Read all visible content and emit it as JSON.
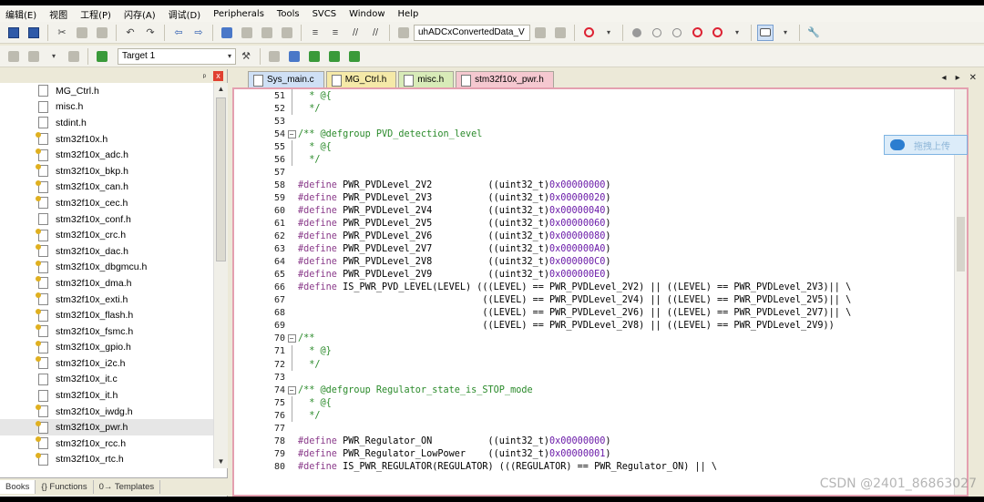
{
  "menu": [
    "编辑(E)",
    "视图",
    "工程(P)",
    "闪存(A)",
    "调试(D)",
    "Peripherals",
    "Tools",
    "SVCS",
    "Window",
    "Help"
  ],
  "toolbar": {
    "function_combo": "uhADCxConvertedData_V",
    "target_combo": "Target 1"
  },
  "project_panel": {
    "pin_label": "ᵖ",
    "close_label": "x",
    "files": [
      {
        "name": "MG_Ctrl.h",
        "key": false
      },
      {
        "name": "misc.h",
        "key": false
      },
      {
        "name": "stdint.h",
        "key": false
      },
      {
        "name": "stm32f10x.h",
        "key": true
      },
      {
        "name": "stm32f10x_adc.h",
        "key": true
      },
      {
        "name": "stm32f10x_bkp.h",
        "key": true
      },
      {
        "name": "stm32f10x_can.h",
        "key": true
      },
      {
        "name": "stm32f10x_cec.h",
        "key": true
      },
      {
        "name": "stm32f10x_conf.h",
        "key": false
      },
      {
        "name": "stm32f10x_crc.h",
        "key": true
      },
      {
        "name": "stm32f10x_dac.h",
        "key": true
      },
      {
        "name": "stm32f10x_dbgmcu.h",
        "key": true
      },
      {
        "name": "stm32f10x_dma.h",
        "key": true
      },
      {
        "name": "stm32f10x_exti.h",
        "key": true
      },
      {
        "name": "stm32f10x_flash.h",
        "key": true
      },
      {
        "name": "stm32f10x_fsmc.h",
        "key": true
      },
      {
        "name": "stm32f10x_gpio.h",
        "key": true
      },
      {
        "name": "stm32f10x_i2c.h",
        "key": true
      },
      {
        "name": "stm32f10x_it.c",
        "key": false
      },
      {
        "name": "stm32f10x_it.h",
        "key": false
      },
      {
        "name": "stm32f10x_iwdg.h",
        "key": true
      },
      {
        "name": "stm32f10x_pwr.h",
        "key": true,
        "selected": true
      },
      {
        "name": "stm32f10x_rcc.h",
        "key": true
      },
      {
        "name": "stm32f10x_rtc.h",
        "key": true
      }
    ],
    "tabs": [
      "Books",
      "{} Functions",
      "0→ Templates"
    ]
  },
  "editor": {
    "tabs": [
      "Sys_main.c",
      "MG_Ctrl.h",
      "misc.h",
      "stm32f10x_pwr.h"
    ],
    "active_tab": 3,
    "lines": [
      {
        "n": "51",
        "fold": "line",
        "t": "  * @{",
        "c": "cmt"
      },
      {
        "n": "52",
        "fold": "line",
        "t": "  */",
        "c": "cmt"
      },
      {
        "n": "53",
        "fold": "",
        "t": "",
        "c": "txt"
      },
      {
        "n": "54",
        "fold": "box",
        "t": "/** @defgroup PVD_detection_level",
        "c": "cmt"
      },
      {
        "n": "55",
        "fold": "line",
        "t": "  * @{",
        "c": "cmt"
      },
      {
        "n": "56",
        "fold": "line",
        "t": "  */",
        "c": "cmt"
      },
      {
        "n": "57",
        "fold": "",
        "t": "",
        "c": "txt"
      },
      {
        "n": "58",
        "fold": "",
        "pp": "#define",
        "t": " PWR_PVDLevel_2V2          ((uint32_t)",
        "hex": "0x00000000",
        "tail": ")"
      },
      {
        "n": "59",
        "fold": "",
        "pp": "#define",
        "t": " PWR_PVDLevel_2V3          ((uint32_t)",
        "hex": "0x00000020",
        "tail": ")"
      },
      {
        "n": "60",
        "fold": "",
        "pp": "#define",
        "t": " PWR_PVDLevel_2V4          ((uint32_t)",
        "hex": "0x00000040",
        "tail": ")"
      },
      {
        "n": "61",
        "fold": "",
        "pp": "#define",
        "t": " PWR_PVDLevel_2V5          ((uint32_t)",
        "hex": "0x00000060",
        "tail": ")"
      },
      {
        "n": "62",
        "fold": "",
        "pp": "#define",
        "t": " PWR_PVDLevel_2V6          ((uint32_t)",
        "hex": "0x00000080",
        "tail": ")"
      },
      {
        "n": "63",
        "fold": "",
        "pp": "#define",
        "t": " PWR_PVDLevel_2V7          ((uint32_t)",
        "hex": "0x000000A0",
        "tail": ")"
      },
      {
        "n": "64",
        "fold": "",
        "pp": "#define",
        "t": " PWR_PVDLevel_2V8          ((uint32_t)",
        "hex": "0x000000C0",
        "tail": ")"
      },
      {
        "n": "65",
        "fold": "",
        "pp": "#define",
        "t": " PWR_PVDLevel_2V9          ((uint32_t)",
        "hex": "0x000000E0",
        "tail": ")"
      },
      {
        "n": "66",
        "fold": "",
        "pp": "#define",
        "t": " IS_PWR_PVD_LEVEL(LEVEL) (((LEVEL) == PWR_PVDLevel_2V2) || ((LEVEL) == PWR_PVDLevel_2V3)|| \\"
      },
      {
        "n": "67",
        "fold": "",
        "t": "                                 ((LEVEL) == PWR_PVDLevel_2V4) || ((LEVEL) == PWR_PVDLevel_2V5)|| \\"
      },
      {
        "n": "68",
        "fold": "",
        "t": "                                 ((LEVEL) == PWR_PVDLevel_2V6) || ((LEVEL) == PWR_PVDLevel_2V7)|| \\"
      },
      {
        "n": "69",
        "fold": "",
        "t": "                                 ((LEVEL) == PWR_PVDLevel_2V8) || ((LEVEL) == PWR_PVDLevel_2V9))"
      },
      {
        "n": "70",
        "fold": "box",
        "t": "/**",
        "c": "cmt"
      },
      {
        "n": "71",
        "fold": "line",
        "t": "  * @}",
        "c": "cmt"
      },
      {
        "n": "72",
        "fold": "line",
        "t": "  */",
        "c": "cmt"
      },
      {
        "n": "73",
        "fold": "",
        "t": "",
        "c": "txt"
      },
      {
        "n": "74",
        "fold": "box",
        "t": "/** @defgroup Regulator_state_is_STOP_mode",
        "c": "cmt"
      },
      {
        "n": "75",
        "fold": "line",
        "t": "  * @{",
        "c": "cmt"
      },
      {
        "n": "76",
        "fold": "line",
        "t": "  */",
        "c": "cmt"
      },
      {
        "n": "77",
        "fold": "",
        "t": "",
        "c": "txt"
      },
      {
        "n": "78",
        "fold": "",
        "pp": "#define",
        "t": " PWR_Regulator_ON          ((uint32_t)",
        "hex": "0x00000000",
        "tail": ")"
      },
      {
        "n": "79",
        "fold": "",
        "pp": "#define",
        "t": " PWR_Regulator_LowPower    ((uint32_t)",
        "hex": "0x00000001",
        "tail": ")"
      },
      {
        "n": "80",
        "fold": "",
        "pp": "#define",
        "t": " IS_PWR_REGULATOR(REGULATOR) (((REGULATOR) == PWR_Regulator_ON) || \\"
      }
    ]
  },
  "upload_button": "拖拽上传",
  "watermark": "CSDN @2401_86863027"
}
